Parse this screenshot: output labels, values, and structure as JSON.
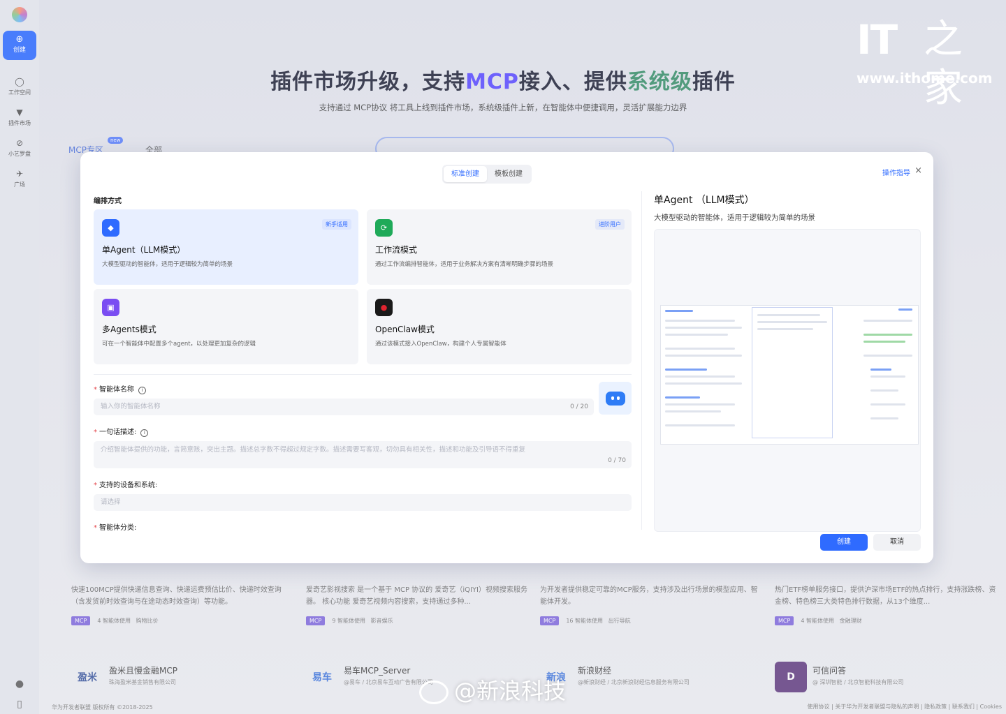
{
  "hero": {
    "title_a": "插件市场升级，支持",
    "title_mcp": "MCP",
    "title_b": "接入、提供",
    "title_sys": "系统级",
    "title_c": "插件",
    "subtitle": "支持通过 MCP协议 将工具上线到插件市场，系统级插件上新，在智能体中便捷调用，灵活扩展能力边界"
  },
  "rail": {
    "create": "创建",
    "items": [
      "工作空间",
      "插件市场",
      "小艺罗盘",
      "广场"
    ]
  },
  "bg_tabs": {
    "mcp": "MCP专区",
    "new": "new",
    "all": "全部"
  },
  "bg_cards": [
    {
      "desc": "快速100MCP提供快递信息查询、快递运费预估比价、快递时效查询（含发货前时效查询与在途动态时效查询）等功能。",
      "tag": "MCP",
      "uses": "4 智能体使用",
      "cat": "购物比价"
    },
    {
      "desc": "爱奇艺影视搜索 是一个基于 MCP 协议的 爱奇艺（iQIYI）视频搜索服务器。 核心功能 爱奇艺视频内容搜索，支持通过多种...",
      "tag": "MCP",
      "uses": "9 智能体使用",
      "cat": "影音娱乐"
    },
    {
      "desc": "为开发者提供稳定可靠的MCP服务，支持涉及出行场景的模型应用、智能体开发。",
      "tag": "MCP",
      "uses": "16 智能体使用",
      "cat": "出行导航"
    },
    {
      "desc": "热门ETF榜单服务接口，提供沪深市场ETF的热点排行，支持涨跌榜、资金榜、特色榜三大类特色排行数据，从13个维度...",
      "tag": "MCP",
      "uses": "4 智能体使用",
      "cat": "金融理财"
    }
  ],
  "bg_providers": [
    {
      "logo": "盈米",
      "name": "盈米且慢金融MCP",
      "sub": "珠海盈米基金销售有限公司"
    },
    {
      "logo": "易车",
      "name": "易车MCP_Server",
      "sub": "@易车 / 北京易车互动广告有限公司"
    },
    {
      "logo": "新浪",
      "name": "新浪财经",
      "sub": "@新浪财经 / 北京新浪财经信息服务有限公司"
    },
    {
      "logo": "D",
      "name": "可信问答",
      "sub": "@ 深圳智能 / 北京智能科技有限公司"
    }
  ],
  "footer": {
    "left": "华为开发者联盟 版权所有 ©2018-2025",
    "right": "使用协议 | 关于华为开发者联盟与隐私的声明 | 隐私政策 | 联系我们 | Cookies"
  },
  "watermark": {
    "it": "IT",
    "zh": "之家",
    "url": "www.ithome.com",
    "sina": "@新浪科技"
  },
  "modal": {
    "tab_standard": "标准创建",
    "tab_template": "模板创建",
    "guide": "操作指导",
    "close": "×",
    "section_label": "编排方式",
    "modes": [
      {
        "title": "单Agent（LLM模式）",
        "desc": "大模型驱动的智能体，适用于逻辑较为简单的场景",
        "badge": "新手适用",
        "color": "#2f6bff",
        "glyph": "◆"
      },
      {
        "title": "工作流模式",
        "desc": "通过工作流编排智能体，适用于业务解决方案有清晰明确步骤的场景",
        "badge": "进阶用户",
        "color": "#1faa59",
        "glyph": "⟳"
      },
      {
        "title": "多Agents模式",
        "desc": "可在一个智能体中配置多个agent，以处理更加复杂的逻辑",
        "badge": "",
        "color": "#7a4df2",
        "glyph": "▣"
      },
      {
        "title": "OpenClaw模式",
        "desc": "通过该模式接入OpenClaw，构建个人专属智能体",
        "badge": "",
        "color": "#d91e2b",
        "glyph": "●"
      }
    ],
    "fields": {
      "name_label": "智能体名称",
      "name_placeholder": "输入你的智能体名称",
      "name_count": "0 / 20",
      "desc_label": "一句话描述:",
      "desc_placeholder": "介绍智能体提供的功能，言简意赅，突出主题。描述总字数不得超过规定字数。描述需要写客观，切勿具有相关性，描述和功能及引导语不得重复",
      "desc_count": "0 / 70",
      "device_label": "支持的设备和系统:",
      "device_placeholder": "请选择",
      "category_label": "智能体分类:"
    },
    "preview": {
      "title": "单Agent （LLM模式）",
      "desc": "大模型驱动的智能体，适用于逻辑较为简单的场景"
    },
    "buttons": {
      "create": "创建",
      "cancel": "取消"
    }
  }
}
